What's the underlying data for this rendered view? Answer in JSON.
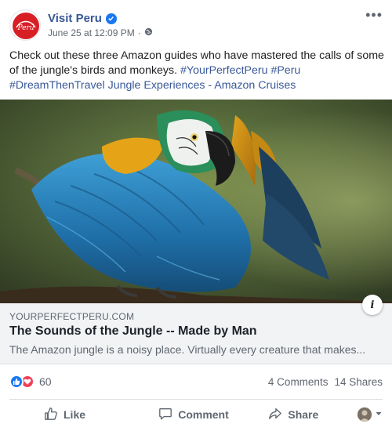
{
  "post": {
    "page_name": "Visit Peru",
    "date": "June 25 at 12:09 PM",
    "separator": "·",
    "text_plain": "Check out these three Amazon guides who have mastered the calls of some of the jungle's birds and monkeys. ",
    "hashtags": [
      "#YourPerfectPeru",
      "#Peru",
      "#DreamThenTravel Jungle Experiences - Amazon Cruises"
    ],
    "logo_text": "Perú"
  },
  "link": {
    "domain": "YOURPERFECTPERU.COM",
    "title": "The Sounds of the Jungle -- Made by Man",
    "description": "The Amazon jungle is a noisy place. Virtually every creature that makes..."
  },
  "stats": {
    "reaction_count": "60",
    "comments": "4 Comments",
    "shares": "14 Shares"
  },
  "actions": {
    "like": "Like",
    "comment": "Comment",
    "share": "Share"
  },
  "icons": {
    "more": "more-options-icon",
    "verified": "verified-badge-icon",
    "globe": "globe-icon",
    "info": "info-icon",
    "info_glyph": "i",
    "like_reaction": "like-reaction-icon",
    "love_reaction": "love-reaction-icon",
    "like_action": "thumbs-up-icon",
    "comment_action": "comment-bubble-icon",
    "share_action": "share-arrow-icon",
    "dropdown": "caret-down-icon"
  },
  "colors": {
    "brand_link": "#385898",
    "like_blue": "#1877f2",
    "love_red": "#f33e58",
    "logo_red": "#d91f26"
  }
}
